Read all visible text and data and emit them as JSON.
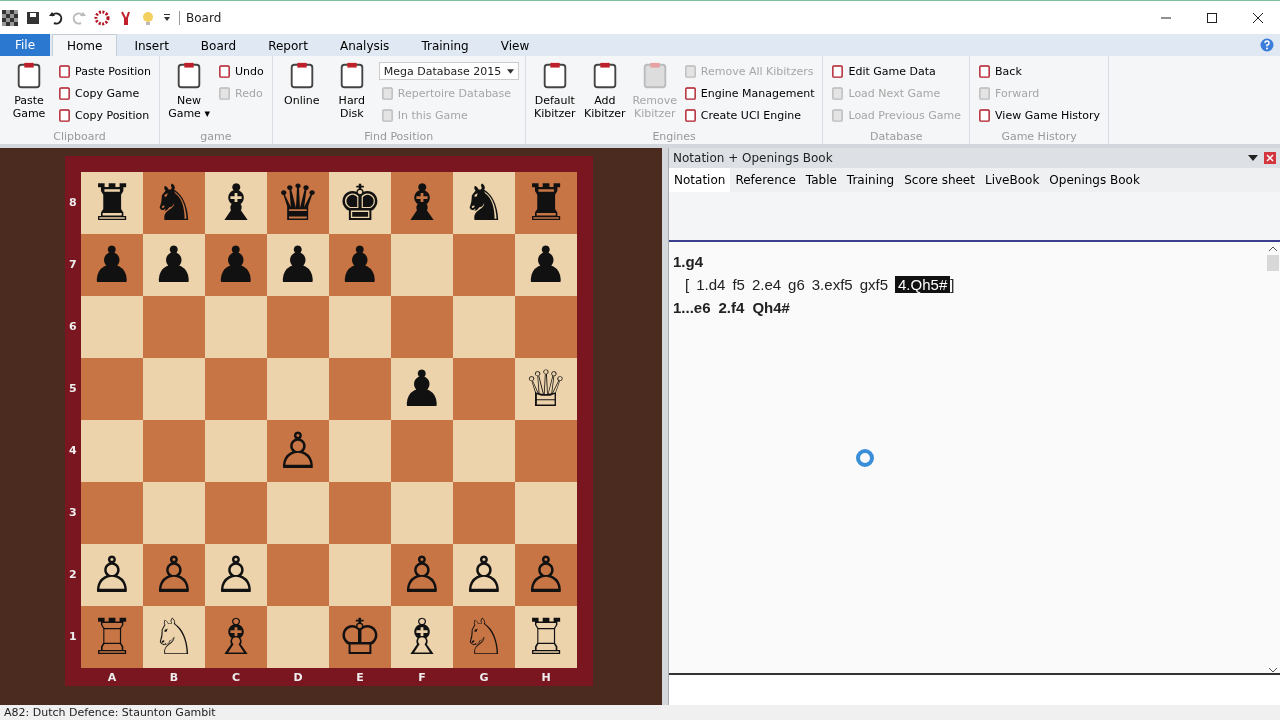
{
  "window": {
    "title": "Board"
  },
  "ribbon_tabs": [
    {
      "label": "File",
      "kind": "file",
      "selected": false
    },
    {
      "label": "Home",
      "kind": "tab",
      "selected": true
    },
    {
      "label": "Insert",
      "kind": "tab",
      "selected": false
    },
    {
      "label": "Board",
      "kind": "tab",
      "selected": false
    },
    {
      "label": "Report",
      "kind": "tab",
      "selected": false
    },
    {
      "label": "Analysis",
      "kind": "tab",
      "selected": false
    },
    {
      "label": "Training",
      "kind": "tab",
      "selected": false
    },
    {
      "label": "View",
      "kind": "tab",
      "selected": false
    }
  ],
  "ribbon_groups": [
    {
      "label": "Clipboard",
      "columns": [
        [
          {
            "kind": "large",
            "label": "Paste Game",
            "disabled": false
          }
        ],
        [
          {
            "kind": "small",
            "label": "Paste Position",
            "disabled": false
          },
          {
            "kind": "small",
            "label": "Copy Game",
            "disabled": false
          },
          {
            "kind": "small",
            "label": "Copy Position",
            "disabled": false
          }
        ]
      ]
    },
    {
      "label": "game",
      "columns": [
        [
          {
            "kind": "large",
            "label": "New Game ▾",
            "disabled": false
          }
        ],
        [
          {
            "kind": "small",
            "label": "Undo",
            "disabled": false
          },
          {
            "kind": "small",
            "label": "Redo",
            "disabled": true
          }
        ]
      ]
    },
    {
      "label": "Find Position",
      "columns": [
        [
          {
            "kind": "large",
            "label": "Online",
            "disabled": false
          }
        ],
        [
          {
            "kind": "large",
            "label": "Hard Disk",
            "disabled": false
          }
        ],
        [
          {
            "kind": "dropdown",
            "label": "Mega Database 2015",
            "disabled": false
          },
          {
            "kind": "small",
            "label": "Repertoire Database",
            "disabled": true
          },
          {
            "kind": "small",
            "label": "In this Game",
            "disabled": true
          }
        ]
      ]
    },
    {
      "label": "Engines",
      "columns": [
        [
          {
            "kind": "large",
            "label": "Default Kibitzer",
            "disabled": false
          }
        ],
        [
          {
            "kind": "large",
            "label": "Add Kibitzer",
            "disabled": false
          }
        ],
        [
          {
            "kind": "large",
            "label": "Remove Kibitzer",
            "disabled": true
          }
        ],
        [
          {
            "kind": "small",
            "label": "Remove All Kibitzers",
            "disabled": true
          },
          {
            "kind": "small",
            "label": "Engine Management",
            "disabled": false
          },
          {
            "kind": "small",
            "label": "Create UCI Engine",
            "disabled": false
          }
        ]
      ]
    },
    {
      "label": "Database",
      "columns": [
        [
          {
            "kind": "small",
            "label": "Edit Game Data",
            "disabled": false
          },
          {
            "kind": "small",
            "label": "Load Next Game",
            "disabled": true
          },
          {
            "kind": "small",
            "label": "Load Previous Game",
            "disabled": true
          }
        ]
      ]
    },
    {
      "label": "Game History",
      "columns": [
        [
          {
            "kind": "small",
            "label": "Back",
            "disabled": false
          },
          {
            "kind": "small",
            "label": "Forward",
            "disabled": true
          },
          {
            "kind": "small",
            "label": "View Game History",
            "disabled": false
          }
        ]
      ]
    }
  ],
  "board": {
    "ranks": [
      {
        "label": "8",
        "squares": [
          {
            "kind": "piece",
            "piece": "♜"
          },
          {
            "kind": "piece",
            "piece": "♞"
          },
          {
            "kind": "piece",
            "piece": "♝"
          },
          {
            "kind": "piece",
            "piece": "♛"
          },
          {
            "kind": "piece",
            "piece": "♚"
          },
          {
            "kind": "piece",
            "piece": "♝"
          },
          {
            "kind": "piece",
            "piece": "♞"
          },
          {
            "kind": "piece",
            "piece": "♜"
          }
        ]
      },
      {
        "label": "7",
        "squares": [
          {
            "kind": "piece",
            "piece": "♟"
          },
          {
            "kind": "piece",
            "piece": "♟"
          },
          {
            "kind": "piece",
            "piece": "♟"
          },
          {
            "kind": "piece",
            "piece": "♟"
          },
          {
            "kind": "piece",
            "piece": "♟"
          },
          {
            "kind": "empty"
          },
          {
            "kind": "empty"
          },
          {
            "kind": "piece",
            "piece": "♟"
          }
        ]
      },
      {
        "label": "6",
        "squares": [
          {
            "kind": "empty"
          },
          {
            "kind": "empty"
          },
          {
            "kind": "empty"
          },
          {
            "kind": "empty"
          },
          {
            "kind": "empty"
          },
          {
            "kind": "empty"
          },
          {
            "kind": "empty"
          },
          {
            "kind": "empty"
          }
        ]
      },
      {
        "label": "5",
        "squares": [
          {
            "kind": "empty"
          },
          {
            "kind": "empty"
          },
          {
            "kind": "empty"
          },
          {
            "kind": "empty"
          },
          {
            "kind": "empty"
          },
          {
            "kind": "piece",
            "piece": "♟"
          },
          {
            "kind": "empty"
          },
          {
            "kind": "piece",
            "piece": "♕"
          }
        ]
      },
      {
        "label": "4",
        "squares": [
          {
            "kind": "empty"
          },
          {
            "kind": "empty"
          },
          {
            "kind": "empty"
          },
          {
            "kind": "piece",
            "piece": "♙"
          },
          {
            "kind": "empty"
          },
          {
            "kind": "empty"
          },
          {
            "kind": "empty"
          },
          {
            "kind": "empty"
          }
        ]
      },
      {
        "label": "3",
        "squares": [
          {
            "kind": "empty"
          },
          {
            "kind": "empty"
          },
          {
            "kind": "empty"
          },
          {
            "kind": "empty"
          },
          {
            "kind": "empty"
          },
          {
            "kind": "empty"
          },
          {
            "kind": "empty"
          },
          {
            "kind": "empty"
          }
        ]
      },
      {
        "label": "2",
        "squares": [
          {
            "kind": "piece",
            "piece": "♙"
          },
          {
            "kind": "piece",
            "piece": "♙"
          },
          {
            "kind": "piece",
            "piece": "♙"
          },
          {
            "kind": "empty"
          },
          {
            "kind": "empty"
          },
          {
            "kind": "piece",
            "piece": "♙"
          },
          {
            "kind": "piece",
            "piece": "♙"
          },
          {
            "kind": "piece",
            "piece": "♙"
          }
        ]
      },
      {
        "label": "1",
        "squares": [
          {
            "kind": "piece",
            "piece": "♖"
          },
          {
            "kind": "piece",
            "piece": "♘"
          },
          {
            "kind": "piece",
            "piece": "♗"
          },
          {
            "kind": "empty"
          },
          {
            "kind": "piece",
            "piece": "♔"
          },
          {
            "kind": "piece",
            "piece": "♗"
          },
          {
            "kind": "piece",
            "piece": "♘"
          },
          {
            "kind": "piece",
            "piece": "♖"
          }
        ]
      }
    ],
    "files": [
      "A",
      "B",
      "C",
      "D",
      "E",
      "F",
      "G",
      "H"
    ]
  },
  "panel": {
    "title": "Notation + Openings Book",
    "tabs": [
      {
        "label": "Notation",
        "selected": true
      },
      {
        "label": "Reference",
        "selected": false
      },
      {
        "label": "Table",
        "selected": false
      },
      {
        "label": "Training",
        "selected": false
      },
      {
        "label": "Score sheet",
        "selected": false
      },
      {
        "label": "LiveBook",
        "selected": false
      },
      {
        "label": "Openings Book",
        "selected": false
      }
    ],
    "lines": [
      {
        "kind": "main",
        "moves": [
          {
            "text": "1.g4",
            "selected": false
          }
        ]
      },
      {
        "kind": "variation",
        "open": "[",
        "close": "]",
        "moves": [
          {
            "text": "1.d4",
            "selected": false
          },
          {
            "text": "f5",
            "selected": false
          },
          {
            "text": "2.e4",
            "selected": false
          },
          {
            "text": "g6",
            "selected": false
          },
          {
            "text": "3.exf5",
            "selected": false
          },
          {
            "text": "gxf5",
            "selected": false
          },
          {
            "text": "4.Qh5#",
            "selected": true
          }
        ]
      },
      {
        "kind": "main",
        "moves": [
          {
            "text": "1...e6",
            "selected": false
          },
          {
            "text": "2.f4",
            "selected": false
          },
          {
            "text": "Qh4#",
            "selected": false
          }
        ]
      }
    ]
  },
  "status_bar": {
    "text": "A82: Dutch Defence: Staunton Gambit"
  }
}
